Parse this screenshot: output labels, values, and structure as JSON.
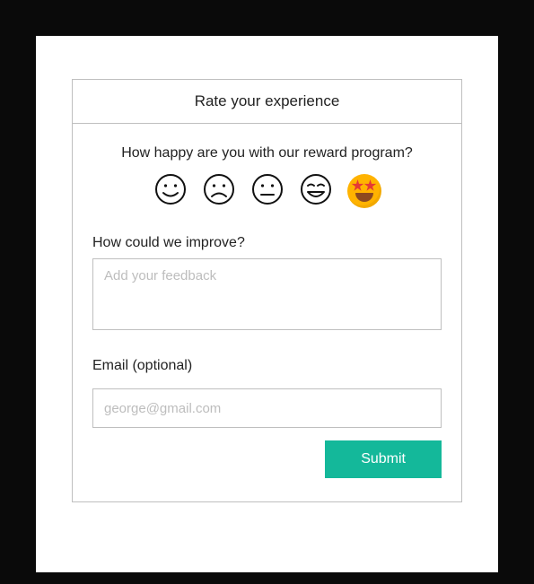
{
  "header": {
    "title": "Rate your experience"
  },
  "rating": {
    "question": "How happy are you with our reward program?",
    "options": [
      {
        "name": "smile-icon"
      },
      {
        "name": "frown-icon"
      },
      {
        "name": "neutral-icon"
      },
      {
        "name": "grin-icon"
      },
      {
        "name": "star-struck-icon"
      }
    ]
  },
  "feedback": {
    "label": "How could we improve?",
    "placeholder": "Add your feedback",
    "value": ""
  },
  "email": {
    "label": "Email (optional)",
    "placeholder": "george@gmail.com",
    "value": ""
  },
  "actions": {
    "submit_label": "Submit"
  },
  "colors": {
    "accent": "#14b89a"
  }
}
